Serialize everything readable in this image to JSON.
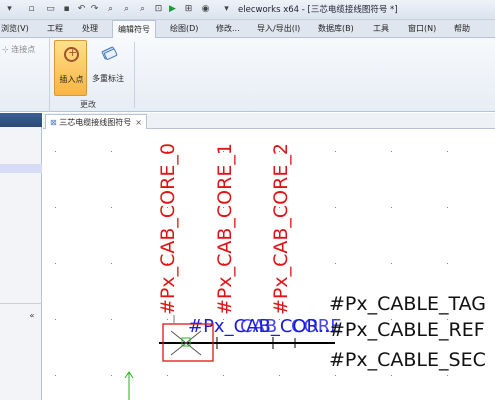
{
  "titlebar": {
    "app_title": "elecworks x64 - [三芯电缆接线图符号 *]"
  },
  "tabs": [
    {
      "label": "浏览(V)"
    },
    {
      "label": "工程"
    },
    {
      "label": "处理"
    },
    {
      "label": "编辑符号",
      "active": true
    },
    {
      "label": "绘图(D)"
    },
    {
      "label": "修改..."
    },
    {
      "label": "导入/导出(I)"
    },
    {
      "label": "数据库(B)"
    },
    {
      "label": "工具"
    },
    {
      "label": "窗口(N)"
    },
    {
      "label": "帮助"
    }
  ],
  "ribbon": {
    "left_label": "连接点",
    "insert_point_label": "插入点",
    "multi_mark_label": "多重标注",
    "group_label": "更改"
  },
  "document": {
    "tab_label": "三芯电缆接线图符号",
    "close_glyph": "×"
  },
  "canvas": {
    "core_labels": [
      "#Px_CAB_CORE_0",
      "#Px_CAB_CORE_1",
      "#Px_CAB_CORE_2"
    ],
    "blue_overlap_label": "#Px_CAB_COR...",
    "blue_overlap_pieces": [
      "#Px_",
      "CAB",
      "CORE",
      "_0"
    ],
    "cable_tag": "#Px_CABLE_TAG",
    "cable_ref": "#Px_CABLE_REF",
    "cable_section": "#Px_CABLE_SEC"
  },
  "colors": {
    "attribute_red": "#e01414",
    "attribute_blue": "#1a1ae6",
    "ribbon_active": "#f8b443",
    "origin_green": "#22b422"
  }
}
